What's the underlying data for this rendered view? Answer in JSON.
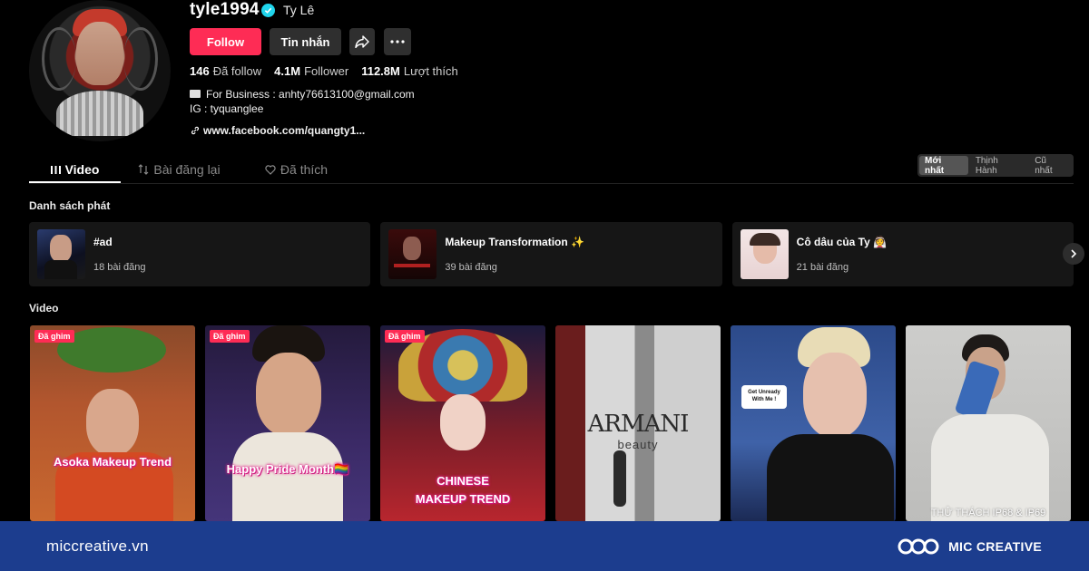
{
  "profile": {
    "username": "tyle1994",
    "nickname": "Ty Lê",
    "follow_label": "Follow",
    "message_label": "Tin nhắn",
    "stats": [
      {
        "value": "146",
        "label": "Đã follow"
      },
      {
        "value": "4.1M",
        "label": "Follower"
      },
      {
        "value": "112.8M",
        "label": "Lượt thích"
      }
    ],
    "bio_line1": "For Business : anhty76613100@gmail.com",
    "bio_line2": "IG : tyquanglee",
    "link": "www.facebook.com/quangty1..."
  },
  "tabs": [
    {
      "label": "Video",
      "icon": "grid-icon"
    },
    {
      "label": "Bài đăng lại",
      "icon": "repost-icon"
    },
    {
      "label": "Đã thích",
      "icon": "heart-icon"
    }
  ],
  "sort": [
    "Mới nhất",
    "Thịnh Hành",
    "Cũ nhất"
  ],
  "playlists_title": "Danh sách phát",
  "playlists": [
    {
      "name": "#ad",
      "count": "18 bài đăng"
    },
    {
      "name": "Makeup Transformation ✨",
      "count": "39 bài đăng"
    },
    {
      "name": "Cô dâu của Ty 👰",
      "count": "21 bài đăng"
    }
  ],
  "videos_title": "Video",
  "videos": [
    {
      "pinned": "Đã ghim",
      "caption": "Asoka Makeup Trend"
    },
    {
      "pinned": "Đã ghim",
      "caption": "Happy Pride Month🏳️‍🌈"
    },
    {
      "pinned": "Đã ghim",
      "caption": "CHINESE MAKEUP TREND"
    },
    {
      "pinned": "",
      "caption": "ARMANI",
      "subcaption": "beauty"
    },
    {
      "pinned": "",
      "caption": "Get Unready With Me !"
    },
    {
      "pinned": "",
      "caption": "THỬ THÁCH IP68 & IP69"
    }
  ],
  "footer": {
    "site": "miccreative.vn",
    "brand": "MIC CREATIVE"
  },
  "colors": {
    "accent": "#fe2c55",
    "footer_bg": "#1c3d8e",
    "verified": "#20d5ec"
  }
}
